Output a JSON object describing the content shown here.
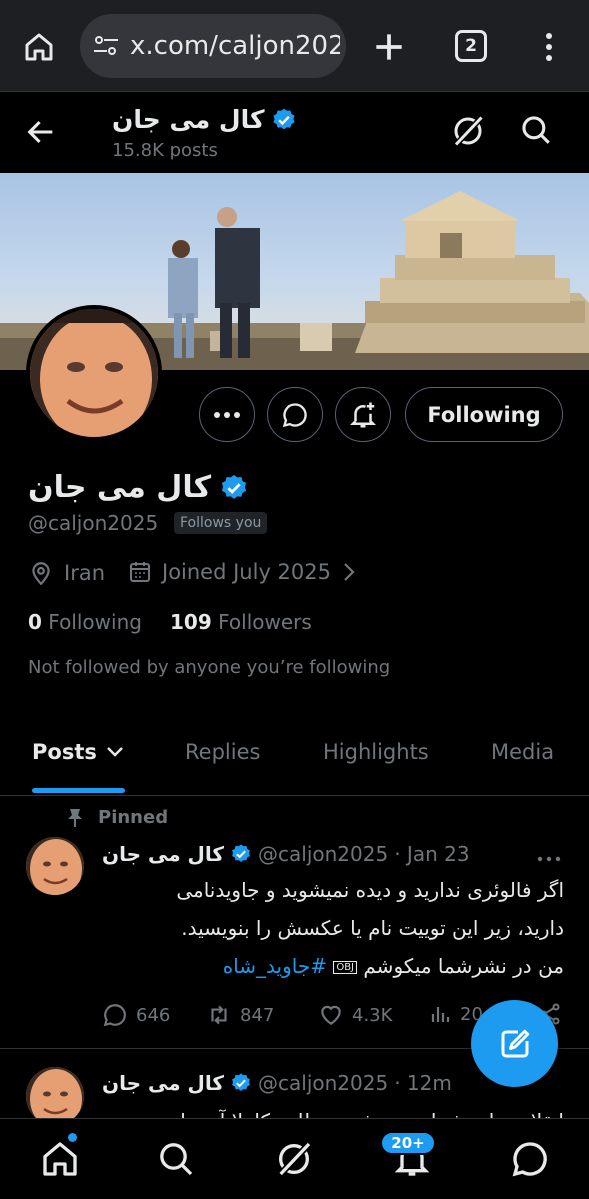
{
  "browser": {
    "url": "x.com/caljon2025",
    "tab_count": "2"
  },
  "header": {
    "name": "کال می جان",
    "posts_count": "15.8K posts"
  },
  "profile": {
    "name": "کال می جان",
    "handle": "@caljon2025",
    "follows_you": "Follows you",
    "location": "Iran",
    "joined": "Joined July 2025",
    "following_count": "0",
    "following_label": "Following",
    "followers_count": "109",
    "followers_label": "Followers",
    "not_followed": "Not followed by anyone you’re following",
    "follow_button": "Following"
  },
  "tabs": [
    {
      "label": "Posts"
    },
    {
      "label": "Replies"
    },
    {
      "label": "Highlights"
    },
    {
      "label": "Media"
    }
  ],
  "posts": [
    {
      "pinned_label": "Pinned",
      "name": "کال می جان",
      "handle": "@caljon2025",
      "time": "· Jan 23",
      "line1": "اگر فالوئری ندارید و دیده نمیشوید و جاویدنامی",
      "line2": "دارید، زیر این توییت نام یا عکسش را بنویسید.",
      "line3_text": "من در نشرشما میکوشم",
      "line3_obj": "OBJ",
      "hashtag": "#جاوید_شاه",
      "replies": "646",
      "reposts": "847",
      "likes": "4.3K",
      "views": "20"
    },
    {
      "name": "کال می جان",
      "handle": "@caljon2025",
      "time": "· 12m",
      "line1": "انقلاب ملی شما پیروز شد به ظاهر کاملا آن جایی"
    }
  ],
  "bottom_nav": {
    "notif_badge": "20+"
  },
  "colors": {
    "accent": "#1d9bf0",
    "background": "#000000",
    "muted": "#71767b",
    "text": "#e7e9ea"
  },
  "icons": [
    "home-icon",
    "tune-icon",
    "plus-icon",
    "tabs-icon",
    "kebab-icon",
    "back-arrow-icon",
    "grok-icon",
    "search-icon",
    "verified-badge-icon",
    "more-icon",
    "message-icon",
    "bell-plus-icon",
    "location-icon",
    "calendar-icon",
    "chevron-right-icon",
    "chevron-down-icon",
    "pin-icon",
    "reply-icon",
    "repost-icon",
    "like-icon",
    "views-icon",
    "share-icon",
    "compose-icon",
    "bell-icon"
  ]
}
